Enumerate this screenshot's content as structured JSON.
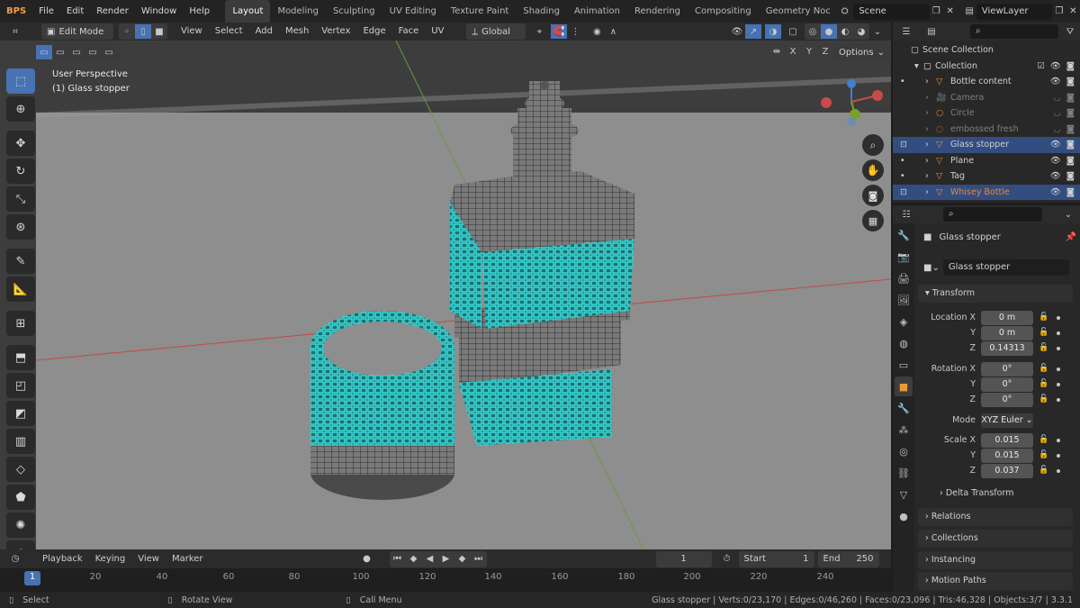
{
  "menubar": {
    "logo_text": "BPS",
    "items": [
      "File",
      "Edit",
      "Render",
      "Window",
      "Help"
    ],
    "workspaces": [
      "Layout",
      "Modeling",
      "Sculpting",
      "UV Editing",
      "Texture Paint",
      "Shading",
      "Animation",
      "Rendering",
      "Compositing",
      "Geometry Noc"
    ],
    "active_workspace": "Layout",
    "scene_label": "Scene",
    "viewlayer_label": "ViewLayer"
  },
  "viewport_header": {
    "mode": "Edit Mode",
    "menus": [
      "View",
      "Select",
      "Add",
      "Mesh",
      "Vertex",
      "Edge",
      "Face",
      "UV"
    ],
    "transform_orientation": "Global",
    "axes": [
      "X",
      "Y",
      "Z"
    ],
    "options_label": "Options"
  },
  "viewport": {
    "perspective_label": "User Perspective",
    "object_label": "(1) Glass stopper",
    "gizmo_axes": [
      "Z",
      "Y",
      "X"
    ]
  },
  "outliner": {
    "root": "Scene Collection",
    "collection": "Collection",
    "items": [
      {
        "name": "Bottle content",
        "dim": false,
        "selected": false
      },
      {
        "name": "Camera",
        "dim": true,
        "selected": false
      },
      {
        "name": "Circle",
        "dim": true,
        "selected": false
      },
      {
        "name": "embossed fresh",
        "dim": true,
        "selected": false
      },
      {
        "name": "Glass stopper",
        "dim": false,
        "selected": true
      },
      {
        "name": "Plane",
        "dim": false,
        "selected": false
      },
      {
        "name": "Tag",
        "dim": false,
        "selected": false
      },
      {
        "name": "Whisey Bottle",
        "dim": false,
        "selected": true
      }
    ]
  },
  "properties": {
    "object_name": "Glass stopper",
    "object_name_field": "Glass stopper",
    "transform_header": "Transform",
    "location": {
      "label": "Location X",
      "x": "0 m",
      "y": "0 m",
      "z": "0.14313"
    },
    "rotation": {
      "label": "Rotation X",
      "x": "0°",
      "y": "0°",
      "z": "0°"
    },
    "mode_label": "Mode",
    "mode_value": "XYZ Euler",
    "scale": {
      "label": "Scale X",
      "x": "0.015",
      "y": "0.015",
      "z": "0.037"
    },
    "axis_y": "Y",
    "axis_z": "Z",
    "delta_transform": "Delta Transform",
    "relations": "Relations",
    "collections": "Collections",
    "instancing": "Instancing",
    "motion_paths": "Motion Paths"
  },
  "timeline": {
    "menus": [
      "Playback",
      "Keying",
      "View",
      "Marker"
    ],
    "current_frame": "1",
    "start_label": "Start",
    "start_value": "1",
    "end_label": "End",
    "end_value": "250",
    "ruler_ticks": [
      "1",
      "20",
      "40",
      "60",
      "80",
      "100",
      "120",
      "140",
      "160",
      "180",
      "200",
      "220",
      "240"
    ]
  },
  "statusbar": {
    "select": "Select",
    "rotate_view": "Rotate View",
    "call_menu": "Call Menu",
    "stats": "Glass stopper | Verts:0/23,170 | Edges:0/46,260 | Faces:0/23,096 | Tris:46,328 | Objects:3/7 | 3.3.1"
  },
  "colors": {
    "accent": "#4772b3",
    "selected_mesh": "#2ee6e6",
    "active_object": "#e8893a"
  }
}
